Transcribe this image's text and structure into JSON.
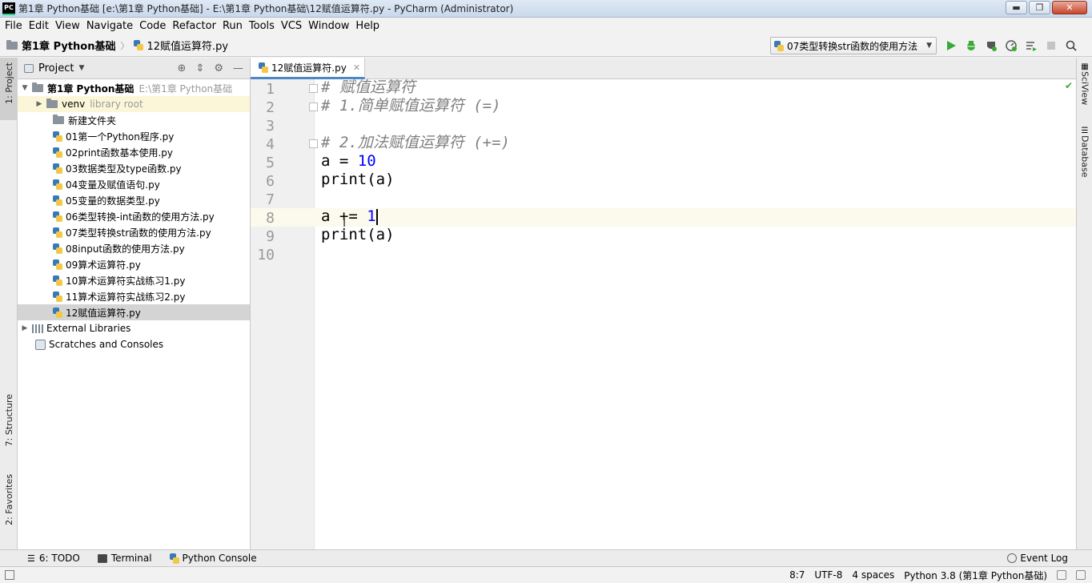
{
  "window": {
    "logo": "PC",
    "title": "第1章 Python基础 [e:\\第1章 Python基础] - E:\\第1章 Python基础\\12赋值运算符.py - PyCharm (Administrator)",
    "btn_min": "▬",
    "btn_max": "❐",
    "btn_close": "✕"
  },
  "menu": [
    "File",
    "Edit",
    "View",
    "Navigate",
    "Code",
    "Refactor",
    "Run",
    "Tools",
    "VCS",
    "Window",
    "Help"
  ],
  "breadcrumb": {
    "project": "第1章 Python基础",
    "file": "12赋值运算符.py"
  },
  "run_config": {
    "label": "07类型转换str函数的使用方法"
  },
  "toolbar_icons": [
    "run-icon",
    "debug-icon",
    "coverage-icon",
    "profile-icon",
    "build-icon",
    "stop-icon",
    "search-everywhere-icon"
  ],
  "left_stripe": {
    "project_tab": "1: Project",
    "structure_tab": "7: Structure",
    "favorites_tab": "2: Favorites"
  },
  "right_stripe": {
    "sciview_tab": "SciView",
    "database_tab": "Database"
  },
  "project_panel": {
    "title": "Project",
    "root": {
      "name": "第1章 Python基础",
      "path": "E:\\第1章 Python基础"
    },
    "venv": {
      "name": "venv",
      "note": "library root"
    },
    "items": [
      "新建文件夹",
      "01第一个Python程序.py",
      "02print函数基本使用.py",
      "03数据类型及type函数.py",
      "04变量及赋值语句.py",
      "05变量的数据类型.py",
      "06类型转换-int函数的使用方法.py",
      "07类型转换str函数的使用方法.py",
      "08input函数的使用方法.py",
      "09算术运算符.py",
      "10算术运算符实战练习1.py",
      "11算术运算符实战练习2.py",
      "12赋值运算符.py"
    ],
    "external_libraries": "External Libraries",
    "scratches": "Scratches and Consoles"
  },
  "editor": {
    "tab_label": "12赋值运算符.py",
    "line_numbers": [
      "1",
      "2",
      "3",
      "4",
      "5",
      "6",
      "7",
      "8",
      "9",
      "10"
    ],
    "lines": {
      "l1": "# 赋值运算符",
      "l2": "# 1.简单赋值运算符 (=)",
      "l3": "",
      "l4": "# 2.加法赋值运算符 (+=)",
      "l5_a": "a = ",
      "l5_num": "10",
      "l6": "print(a)",
      "l7": "",
      "l8_a": "a += ",
      "l8_num": "1",
      "l9": "print(a)",
      "l10": ""
    }
  },
  "bottom_tools": {
    "todo": "6: TODO",
    "terminal": "Terminal",
    "python_console": "Python Console",
    "event_log": "Event Log"
  },
  "status": {
    "position": "8:7",
    "encoding": "UTF-8",
    "indent": "4 spaces",
    "interpreter": "Python 3.8 (第1章 Python基础)"
  },
  "colors": {
    "accent": "#4a88c7",
    "run_green": "#3aaa35",
    "number_blue": "#0000ff",
    "comment_gray": "#808080"
  }
}
